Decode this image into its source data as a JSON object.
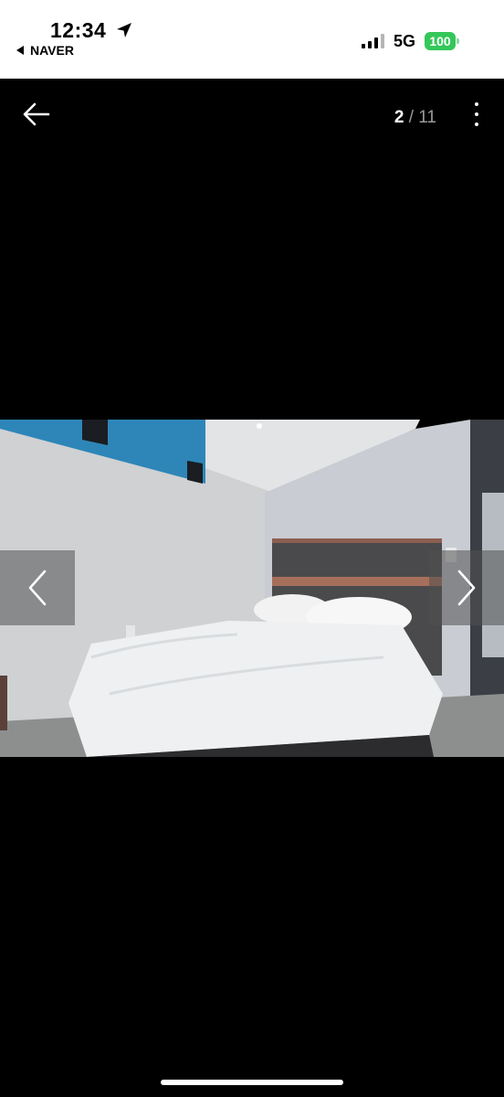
{
  "status_bar": {
    "time": "12:34",
    "back_app": "NAVER",
    "network": "5G",
    "battery": "100",
    "icons": [
      "location-arrow-icon",
      "signal-bars-icon",
      "battery-icon"
    ],
    "battery_color": "#34c759"
  },
  "viewer": {
    "current_index": "2",
    "separator": "/",
    "total": "11",
    "icons": [
      "back-arrow-icon",
      "more-vertical-icon",
      "chevron-left-icon",
      "chevron-right-icon"
    ]
  },
  "photo": {
    "subject": "hotel room with a double bed"
  }
}
